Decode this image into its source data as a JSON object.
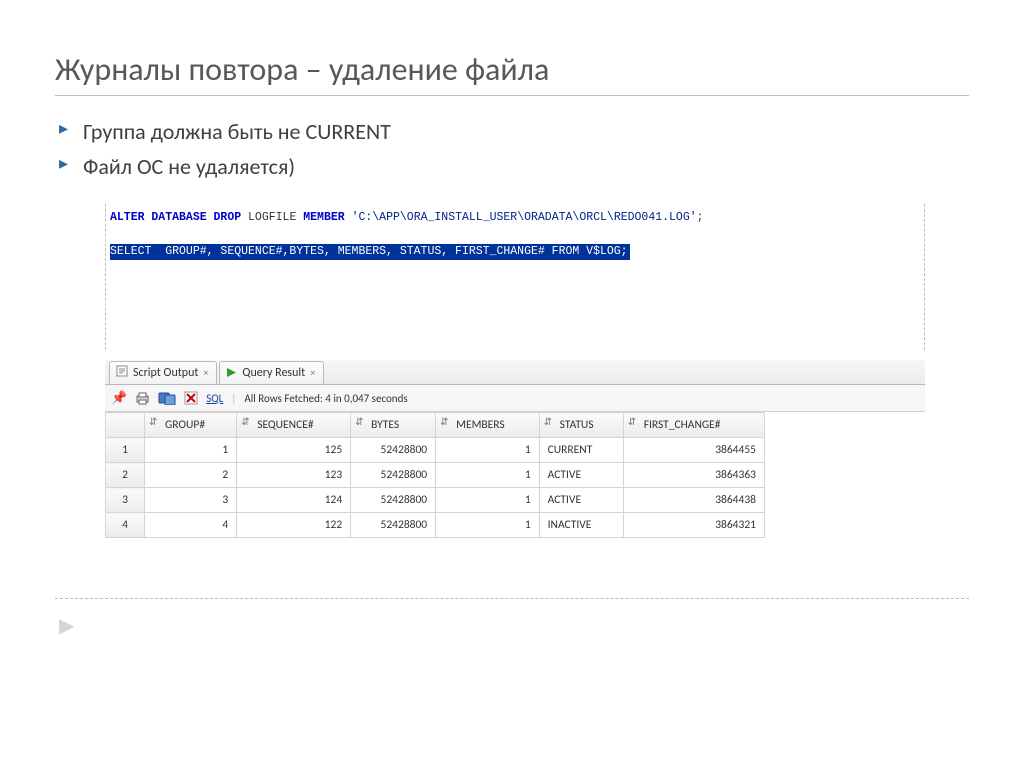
{
  "title": "Журналы повтора – удаление файла",
  "bullets": [
    "Группа должна быть не CURRENT",
    "Файл ОС не удаляется)"
  ],
  "sql": {
    "line1_kw": "ALTER DATABASE DROP",
    "line1_mid": "LOGFILE",
    "line1_kw2": "MEMBER",
    "line1_str": "'C:\\APP\\ORA_INSTALL_USER\\ORADATA\\ORCL\\REDO041.LOG'",
    "line1_end": ";",
    "line2": "SELECT  GROUP#, SEQUENCE#,BYTES, MEMBERS, STATUS, FIRST_CHANGE# FROM V$LOG;"
  },
  "tabs": {
    "script_output": "Script Output",
    "query_result": "Query Result"
  },
  "toolbar": {
    "sql_label": "SQL",
    "fetch_status": "All Rows Fetched: 4 in 0,047 seconds"
  },
  "columns": [
    "GROUP#",
    "SEQUENCE#",
    "BYTES",
    "MEMBERS",
    "STATUS",
    "FIRST_CHANGE#"
  ],
  "rows": [
    {
      "n": "1",
      "group": "1",
      "seq": "125",
      "bytes": "52428800",
      "members": "1",
      "status": "CURRENT",
      "fc": "3864455"
    },
    {
      "n": "2",
      "group": "2",
      "seq": "123",
      "bytes": "52428800",
      "members": "1",
      "status": "ACTIVE",
      "fc": "3864363"
    },
    {
      "n": "3",
      "group": "3",
      "seq": "124",
      "bytes": "52428800",
      "members": "1",
      "status": "ACTIVE",
      "fc": "3864438"
    },
    {
      "n": "4",
      "group": "4",
      "seq": "122",
      "bytes": "52428800",
      "members": "1",
      "status": "INACTIVE",
      "fc": "3864321"
    }
  ]
}
